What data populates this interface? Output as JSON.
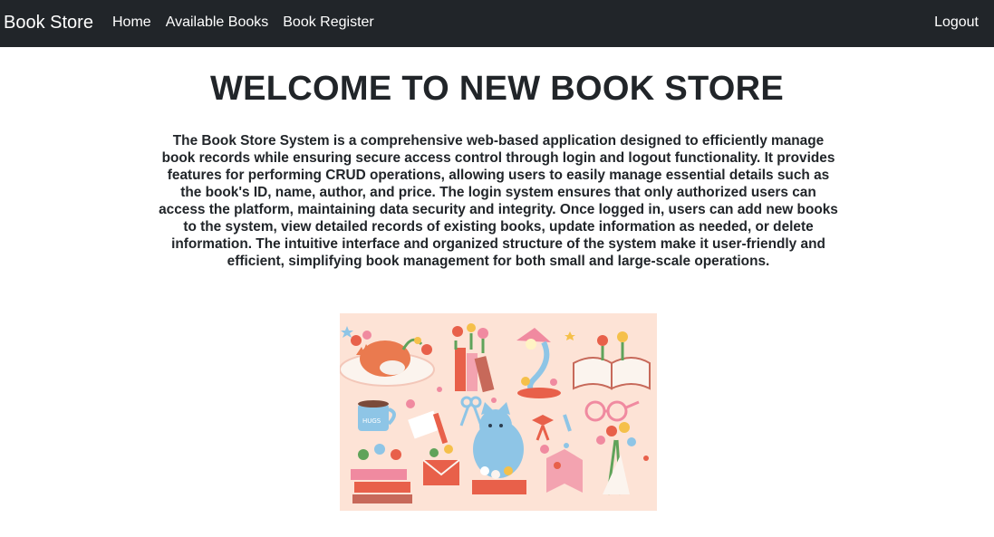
{
  "navbar": {
    "brand": "Book Store",
    "links": [
      "Home",
      "Available Books",
      "Book Register"
    ],
    "logout": "Logout"
  },
  "main": {
    "title": "WELCOME TO NEW BOOK STORE",
    "description": "The Book Store System is a comprehensive web-based application designed to efficiently manage book records while ensuring secure access control through login and logout functionality. It provides features for performing CRUD operations, allowing users to easily manage essential details such as the book's ID, name, author, and price. The login system ensures that only authorized users can access the platform, maintaining data security and integrity. Once logged in, users can add new books to the system, view detailed records of existing books, update information as needed, or delete information. The intuitive interface and organized structure of the system make it user-friendly and efficient, simplifying book management for both small and large-scale operations."
  },
  "illustration": {
    "mug_text": "HUGS",
    "colors": {
      "background": "#fde3d6",
      "accent_red": "#e8604a",
      "accent_pink": "#f08aa0",
      "accent_blue": "#8ec5e6",
      "accent_green": "#5fa35a",
      "accent_yellow": "#f5c04a"
    }
  }
}
